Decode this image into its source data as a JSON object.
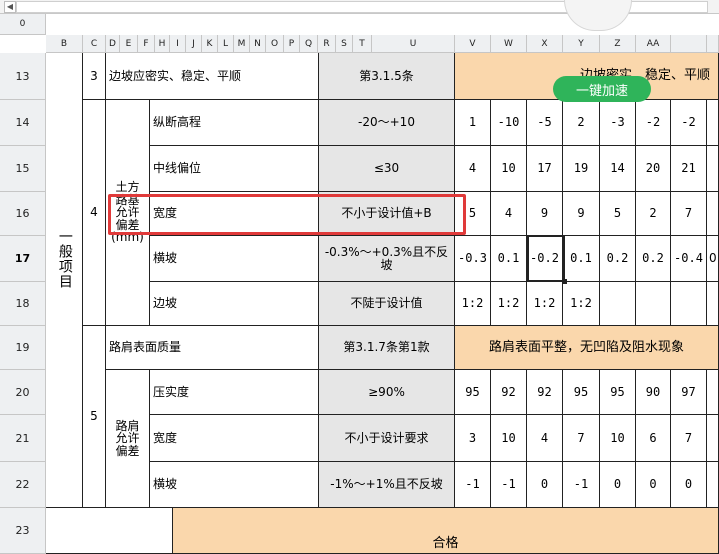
{
  "app": {
    "name_box_arrow": "◀"
  },
  "columns": {
    "corner": "0",
    "headers": [
      "B",
      "C",
      "D",
      "E",
      "F",
      "H",
      "I",
      "J",
      "K",
      "L",
      "M",
      "N",
      "O",
      "P",
      "Q",
      "R",
      "S",
      "T",
      "U",
      "V",
      "W",
      "X",
      "Y",
      "Z",
      "AA"
    ]
  },
  "rows": [
    "13",
    "14",
    "15",
    "16",
    "17",
    "18",
    "19",
    "20",
    "21",
    "22",
    "23"
  ],
  "active_row": "17",
  "content": {
    "group_main": "一般项目",
    "idx_3": "3",
    "idx_4": "4",
    "idx_5": "5",
    "r13_item": "边坡应密实、稳定、平顺",
    "r13_std": "第3.1.5条",
    "r13_result": "边坡密实、稳定、平顺",
    "soil_group": "土方路基允许偏差(mm)",
    "r14_item": "纵断高程",
    "r14_std": "-20～+10",
    "r15_item": "中线偏位",
    "r15_std": "≤30",
    "r16_item": "宽度",
    "r16_std": "不小于设计值+B",
    "r17_item": "横坡",
    "r17_std": "-0.3%～+0.3%且不反坡",
    "r18_item": "边坡",
    "r18_std": "不陡于设计值",
    "r19_item": "路肩表面质量",
    "r19_std": "第3.1.7条第1款",
    "r19_result": "路肩表面平整，无凹陷及阻水现象",
    "shoulder_group": "路肩允许偏差",
    "r20_item": "压实度",
    "r20_std": "≥90%",
    "r21_item": "宽度",
    "r21_std": "不小于设计要求",
    "r22_item": "横坡",
    "r22_std": "-1%～+1%且不反坡",
    "r23_result": "合格"
  },
  "values": {
    "r14": [
      "1",
      "-10",
      "-5",
      "2",
      "-3",
      "-2",
      "-2"
    ],
    "r15": [
      "4",
      "10",
      "17",
      "19",
      "14",
      "20",
      "21"
    ],
    "r16": [
      "5",
      "4",
      "9",
      "9",
      "5",
      "2",
      "7"
    ],
    "r17": [
      "-0.3",
      "0.1",
      "-0.2",
      "0.1",
      "0.2",
      "0.2",
      "-0.4"
    ],
    "r17_extra": "0",
    "r18": [
      "1:2",
      "1:2",
      "1:2",
      "1:2",
      "",
      "",
      " "
    ],
    "r20": [
      "95",
      "92",
      "92",
      "95",
      "95",
      "90",
      "97"
    ],
    "r21": [
      "3",
      "10",
      "4",
      "7",
      "10",
      "6",
      "7"
    ],
    "r22": [
      "-1",
      "-1",
      "0",
      "-1",
      "0",
      "0",
      "0"
    ]
  },
  "overlay": {
    "speed_button": "一键加速"
  },
  "colors": {
    "peach": "#fad7ac",
    "grey": "#e6e6e6",
    "highlight_box": "#e03a3a",
    "speed_button": "#2fb45a"
  }
}
